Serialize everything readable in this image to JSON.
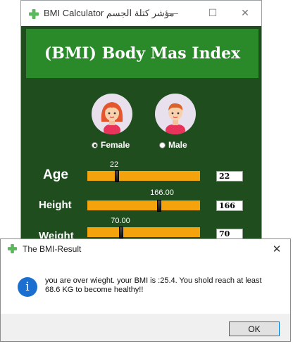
{
  "main_window": {
    "title": "BMI Calculator مؤشر كتلة الجسم",
    "controls": {
      "minimize": "—",
      "maximize": "☐",
      "close": "✕"
    },
    "header": "(BMI) Body Mas Index",
    "gender": {
      "female_label": "Female",
      "male_label": "Male",
      "selected": "Female"
    },
    "sliders": [
      {
        "label": "Age",
        "value_text": "22",
        "box": "22",
        "fraction": 0.26
      },
      {
        "label": "Height",
        "value_text": "166.00",
        "box": "166",
        "fraction": 0.64
      },
      {
        "label": "Weight",
        "value_text": "70.00",
        "box": "70",
        "fraction": 0.3
      }
    ]
  },
  "dialog": {
    "title": "The BMI-Result",
    "close": "✕",
    "message": "you are over wieght. your BMI is :25.4. You shold reach at least 68.6 KG to become healthy!!",
    "ok_label": "OK"
  },
  "colors": {
    "window_bg": "#1f4d1e",
    "header_bg": "#2a8a2a",
    "slider_track": "#f4a30d",
    "info_blue": "#1a6fd0"
  }
}
